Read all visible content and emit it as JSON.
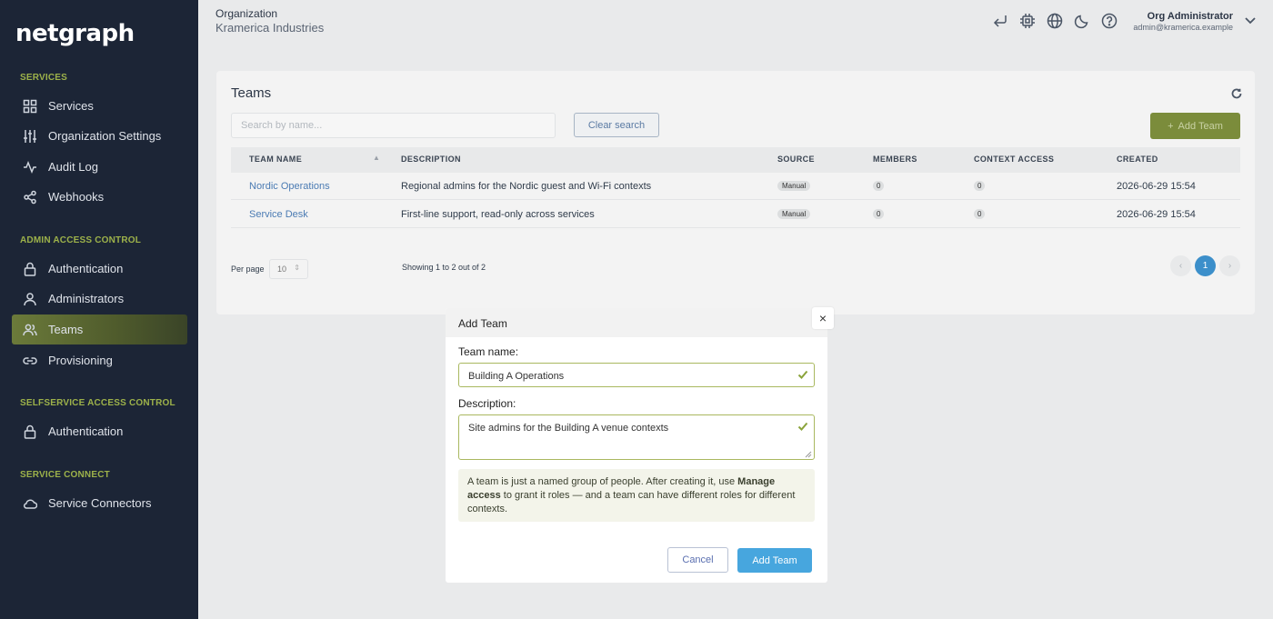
{
  "app": {
    "logo": "netgraph"
  },
  "sidebar": {
    "sections": [
      {
        "title": "SERVICES"
      },
      {
        "title": "ADMIN ACCESS CONTROL"
      },
      {
        "title": "SELFSERVICE ACCESS CONTROL"
      },
      {
        "title": "SERVICE CONNECT"
      }
    ],
    "items": [
      {
        "label": "Services",
        "icon": "grid-icon"
      },
      {
        "label": "Organization Settings",
        "icon": "sliders-icon"
      },
      {
        "label": "Audit Log",
        "icon": "activity-icon"
      },
      {
        "label": "Webhooks",
        "icon": "share-icon"
      },
      {
        "label": "Authentication",
        "icon": "lock-icon"
      },
      {
        "label": "Administrators",
        "icon": "user-icon"
      },
      {
        "label": "Teams",
        "icon": "users-icon",
        "active": true
      },
      {
        "label": "Provisioning",
        "icon": "link-icon"
      },
      {
        "label": "Authentication",
        "icon": "lock-icon"
      },
      {
        "label": "Service Connectors",
        "icon": "cloud-icon"
      }
    ]
  },
  "topbar": {
    "org_label": "Organization",
    "org_name": "Kramerica Industries",
    "icons": [
      "return-icon",
      "chip-icon",
      "globe-icon",
      "moon-icon",
      "help-icon"
    ],
    "user_name": "Org Administrator",
    "user_email": "admin@kramerica.example"
  },
  "teams": {
    "title": "Teams",
    "search_placeholder": "Search by name...",
    "clear_search": "Clear search",
    "add_team": "Add Team",
    "columns": [
      "TEAM NAME",
      "DESCRIPTION",
      "SOURCE",
      "MEMBERS",
      "CONTEXT ACCESS",
      "CREATED"
    ],
    "rows": [
      {
        "name": "Nordic Operations",
        "description": "Regional admins for the Nordic guest and Wi-Fi contexts",
        "source": "Manual",
        "members": "0",
        "context_access": "0",
        "created": "2026-06-29 15:54"
      },
      {
        "name": "Service Desk",
        "description": "First-line support, read-only across services",
        "source": "Manual",
        "members": "0",
        "context_access": "0",
        "created": "2026-06-29 15:54"
      }
    ],
    "per_page_label": "Per page",
    "per_page_value": "10",
    "showing": "Showing 1 to 2 out of 2",
    "current_page": "1"
  },
  "modal": {
    "title": "Add Team",
    "close": "×",
    "name_label": "Team name:",
    "name_value": "Building A Operations",
    "description_label": "Description:",
    "description_value": "Site admins for the Building A venue contexts",
    "info_pre": "A team is just a named group of people. After creating it, use ",
    "info_bold": "Manage access",
    "info_post": " to grant it roles — and a team can have different roles for different contexts.",
    "cancel": "Cancel",
    "submit": "Add Team"
  },
  "colors": {
    "sidebar_bg": "#1c2536",
    "accent_green": "#7b8c3b",
    "section_title": "#9db24a",
    "link_blue": "#4b7bb3",
    "primary_button": "#47a6de"
  }
}
